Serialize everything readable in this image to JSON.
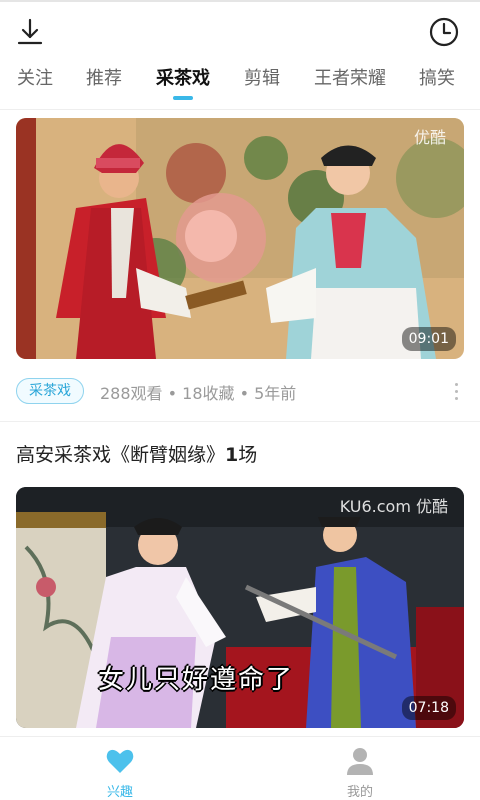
{
  "header": {
    "download_icon": "download-icon",
    "history_icon": "clock-icon"
  },
  "tabs": [
    {
      "label": "关注",
      "active": false
    },
    {
      "label": "推荐",
      "active": false
    },
    {
      "label": "采茶戏",
      "active": true
    },
    {
      "label": "剪辑",
      "active": false
    },
    {
      "label": "王者荣耀",
      "active": false
    },
    {
      "label": "搞笑",
      "active": false
    }
  ],
  "feed": {
    "card1": {
      "watermark": "优酷",
      "duration": "09:01",
      "tag": "采茶戏",
      "meta": "288观看 • 18收藏 • 5年前"
    },
    "card2": {
      "title_prefix": "高安采茶戏《断臂姻缘》",
      "title_bold": "1",
      "title_suffix": "场",
      "watermark": "KU6.com 优酷",
      "subtitle": "女儿只好遵命了",
      "duration": "07:18"
    }
  },
  "bottom_nav": {
    "interest": {
      "label": "兴趣",
      "icon": "heart-icon"
    },
    "mine": {
      "label": "我的",
      "icon": "user-icon"
    }
  },
  "colors": {
    "accent": "#3ab8e8",
    "inactive": "#999999"
  }
}
